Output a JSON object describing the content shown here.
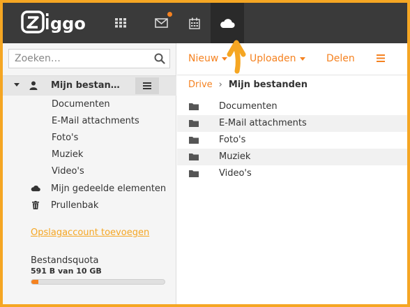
{
  "brand": {
    "logo_text": "ziggo"
  },
  "topnav": {
    "items": [
      {
        "name": "apps",
        "icon": "grid-icon"
      },
      {
        "name": "mail",
        "icon": "envelope-icon",
        "has_notification": true
      },
      {
        "name": "calendar",
        "icon": "calendar-icon"
      },
      {
        "name": "drive",
        "icon": "cloud-icon",
        "active": true
      }
    ]
  },
  "search": {
    "placeholder": "Zoeken…",
    "value": ""
  },
  "sidebar": {
    "root_label": "Mijn bestan…",
    "folders": [
      "Documenten",
      "E-Mail attachments",
      "Foto's",
      "Muziek",
      "Video's"
    ],
    "shared_label": "Mijn gedeelde elementen",
    "trash_label": "Prullenbak",
    "add_account_label": "Opslagaccount toevoegen",
    "quota_title": "Bestandsquota",
    "quota_value": "591 B van 10 GB",
    "quota_fraction": 0.05
  },
  "toolbar": {
    "new_label": "Nieuw",
    "upload_label": "Uploaden",
    "share_label": "Delen"
  },
  "breadcrumb": {
    "root": "Drive",
    "separator": "›",
    "current": "Mijn bestanden"
  },
  "files": [
    {
      "name": "Documenten",
      "type": "folder"
    },
    {
      "name": "E-Mail attachments",
      "type": "folder"
    },
    {
      "name": "Foto's",
      "type": "folder"
    },
    {
      "name": "Muziek",
      "type": "folder"
    },
    {
      "name": "Video's",
      "type": "folder"
    }
  ],
  "colors": {
    "accent": "#f58220",
    "border": "#f5a623",
    "topbar": "#3a3a3a"
  }
}
